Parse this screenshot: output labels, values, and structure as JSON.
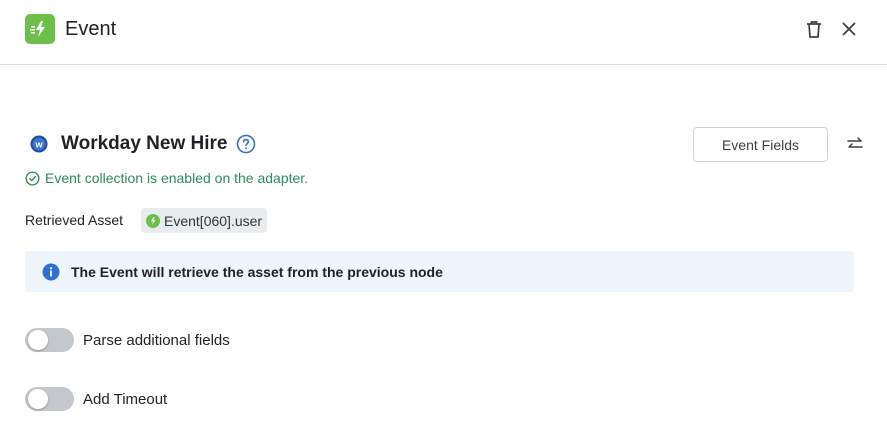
{
  "header": {
    "title": "Event",
    "app_icon": "event-bolt-icon",
    "delete_icon": "trash-icon",
    "close_icon": "close-icon"
  },
  "adapter": {
    "name": "Workday New Hire",
    "icon": "workday-logo-icon",
    "help_icon": "help-circle-icon",
    "status_text": "Event collection is enabled on the adapter.",
    "event_fields_label": "Event Fields",
    "swap_icon": "swap-arrows-icon"
  },
  "retrieved": {
    "label": "Retrieved Asset",
    "value": "Event[060].user"
  },
  "info": {
    "text": "The Event will retrieve the asset from the previous node"
  },
  "toggles": [
    {
      "label": "Parse additional fields",
      "enabled": false
    },
    {
      "label": "Add Timeout",
      "enabled": false
    }
  ],
  "colors": {
    "brand_green": "#6cc04a",
    "status_green": "#2e8b57",
    "info_blue": "#2f6fd6",
    "info_bg": "#eef5fd"
  }
}
